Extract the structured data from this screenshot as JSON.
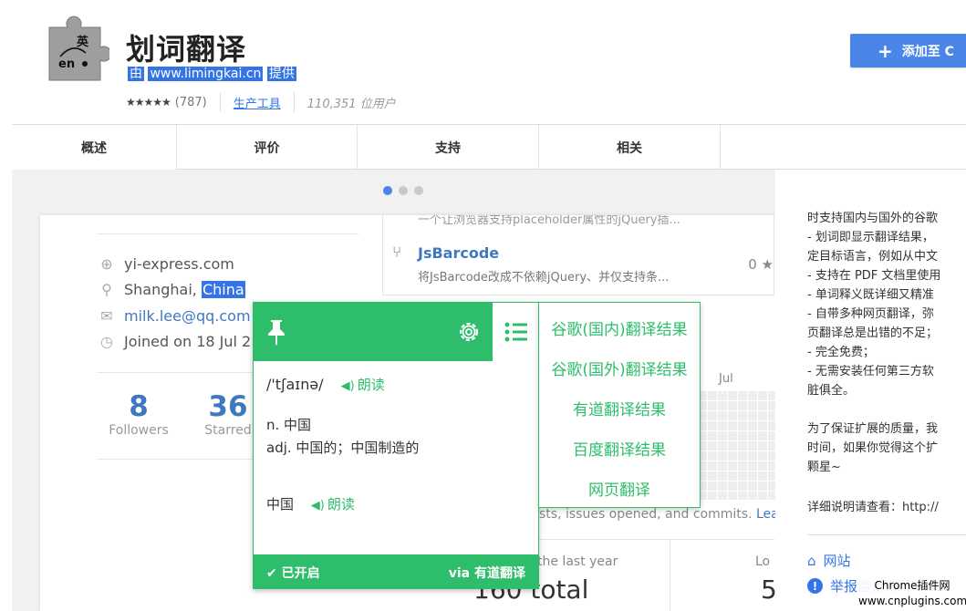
{
  "header": {
    "title": "划词翻译",
    "byline_prefix": "由",
    "byline_site": "www.limingkai.cn",
    "byline_suffix": "提供",
    "stars": "★★★★★",
    "rating_count": "(787)",
    "category": "生产工具",
    "users": "110,351 位用户",
    "add_button": "添加至 C"
  },
  "tabs": [
    "概述",
    "评价",
    "支持",
    "相关"
  ],
  "gallery": {
    "dots": 3,
    "active_dot": 0
  },
  "profile": {
    "site": "yi-express.com",
    "location_prefix": "Shanghai, ",
    "location_highlight": "China",
    "email": "milk.lee@qq.com",
    "joined": "Joined on 18 Jul 2",
    "followers_num": "8",
    "followers_label": "Followers",
    "starred_num": "36",
    "starred_label": "Starred"
  },
  "repo": {
    "faint_desc": "一个让浏览器支持placeholder属性的jQuery插...",
    "name": "JsBarcode",
    "desc": "将JsBarcode改成不依赖jQuery、并仅支持条...",
    "stars": "0 ★"
  },
  "contrib": {
    "month": "Jul",
    "note_text": "sts, issues opened, and commits.",
    "note_link": "Lea",
    "total_label": "the last year",
    "total_value": "160 total",
    "lo_label": "Lo",
    "five": "5"
  },
  "popup": {
    "phonetic": "/'tʃaɪnə/",
    "speak_label": "朗读",
    "def1": "n. 中国",
    "def2": "adj. 中国的；中国制造的",
    "word": "中国",
    "enabled": "✔ 已开启",
    "via": "via 有道翻译",
    "accent": "#2ebd6b"
  },
  "engines": [
    "谷歌(国内)翻译结果",
    "谷歌(国外)翻译结果",
    "有道翻译结果",
    "百度翻译结果",
    "网页翻译"
  ],
  "description": [
    "时支持国内与国外的谷歌",
    " - 划词即显示翻译结果，",
    "定目标语言，例如从中文",
    " - 支持在 PDF 文档里使用",
    " - 单词释义既详细又精准",
    " - 自带多种网页翻译，弥",
    "页翻译总是出错的不足；",
    " - 完全免费；",
    " - 无需安装任何第三方软",
    "脏俱全。",
    "",
    "为了保证扩展的质量，我",
    "时间，如果你觉得这个扩",
    "颗星~",
    "",
    "详细说明请查看：http://"
  ],
  "links": {
    "website": "网站",
    "report": "举报滥用情况"
  },
  "watermark": {
    "line1": "Chrome插件网",
    "line2": "www.cnplugins.com"
  }
}
